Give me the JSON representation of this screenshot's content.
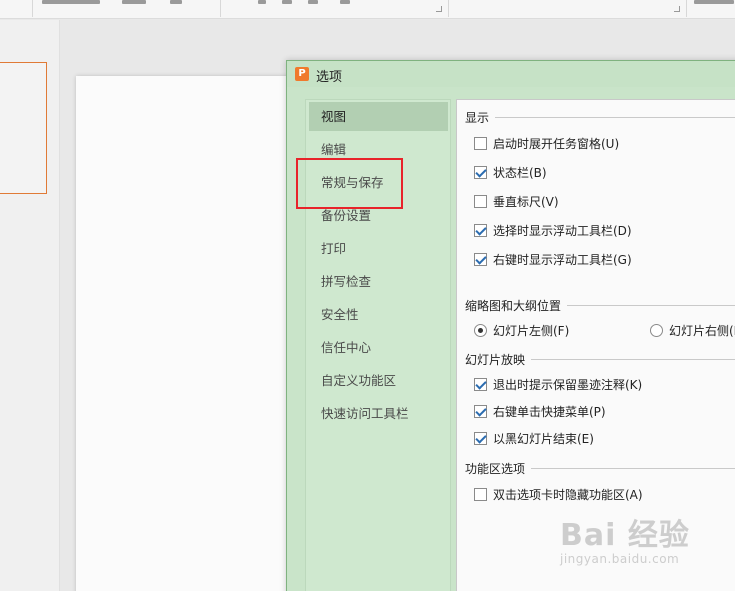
{
  "dialog": {
    "title": "选项",
    "app_icon_letter": "P"
  },
  "nav": {
    "selected": "视图",
    "items": [
      "视图",
      "编辑",
      "常规与保存",
      "备份设置",
      "打印",
      "拼写检查",
      "安全性",
      "信任中心",
      "自定义功能区",
      "快速访问工具栏"
    ]
  },
  "sections": {
    "display": {
      "title": "显示",
      "options": [
        {
          "label": "启动时展开任务窗格(U)",
          "checked": false
        },
        {
          "label": "状态栏(B)",
          "checked": true
        },
        {
          "label": "垂直标尺(V)",
          "checked": false
        },
        {
          "label": "选择时显示浮动工具栏(D)",
          "checked": true
        },
        {
          "label": "右键时显示浮动工具栏(G)",
          "checked": true
        }
      ]
    },
    "thumbnail": {
      "title": "缩略图和大纲位置",
      "options": [
        {
          "label": "幻灯片左侧(F)",
          "selected": true
        },
        {
          "label": "幻灯片右侧(R)",
          "selected": false
        }
      ]
    },
    "slideshow": {
      "title": "幻灯片放映",
      "options": [
        {
          "label": "退出时提示保留墨迹注释(K)",
          "checked": true
        },
        {
          "label": "右键单击快捷菜单(P)",
          "checked": true
        },
        {
          "label": "以黑幻灯片结束(E)",
          "checked": true
        }
      ]
    },
    "ribbon": {
      "title": "功能区选项",
      "options": [
        {
          "label": "双击选项卡时隐藏功能区(A)",
          "checked": false
        }
      ]
    }
  },
  "watermark": {
    "main": "Bai 经验",
    "sub": "jingyan.baidu.com"
  },
  "colors": {
    "highlight_box": "#e8232a",
    "dialog_green": "#c9e4c9",
    "selected_nav": "#b2cfb2",
    "app_icon": "#f07a2c",
    "thumbnail_border": "#e07a36"
  }
}
